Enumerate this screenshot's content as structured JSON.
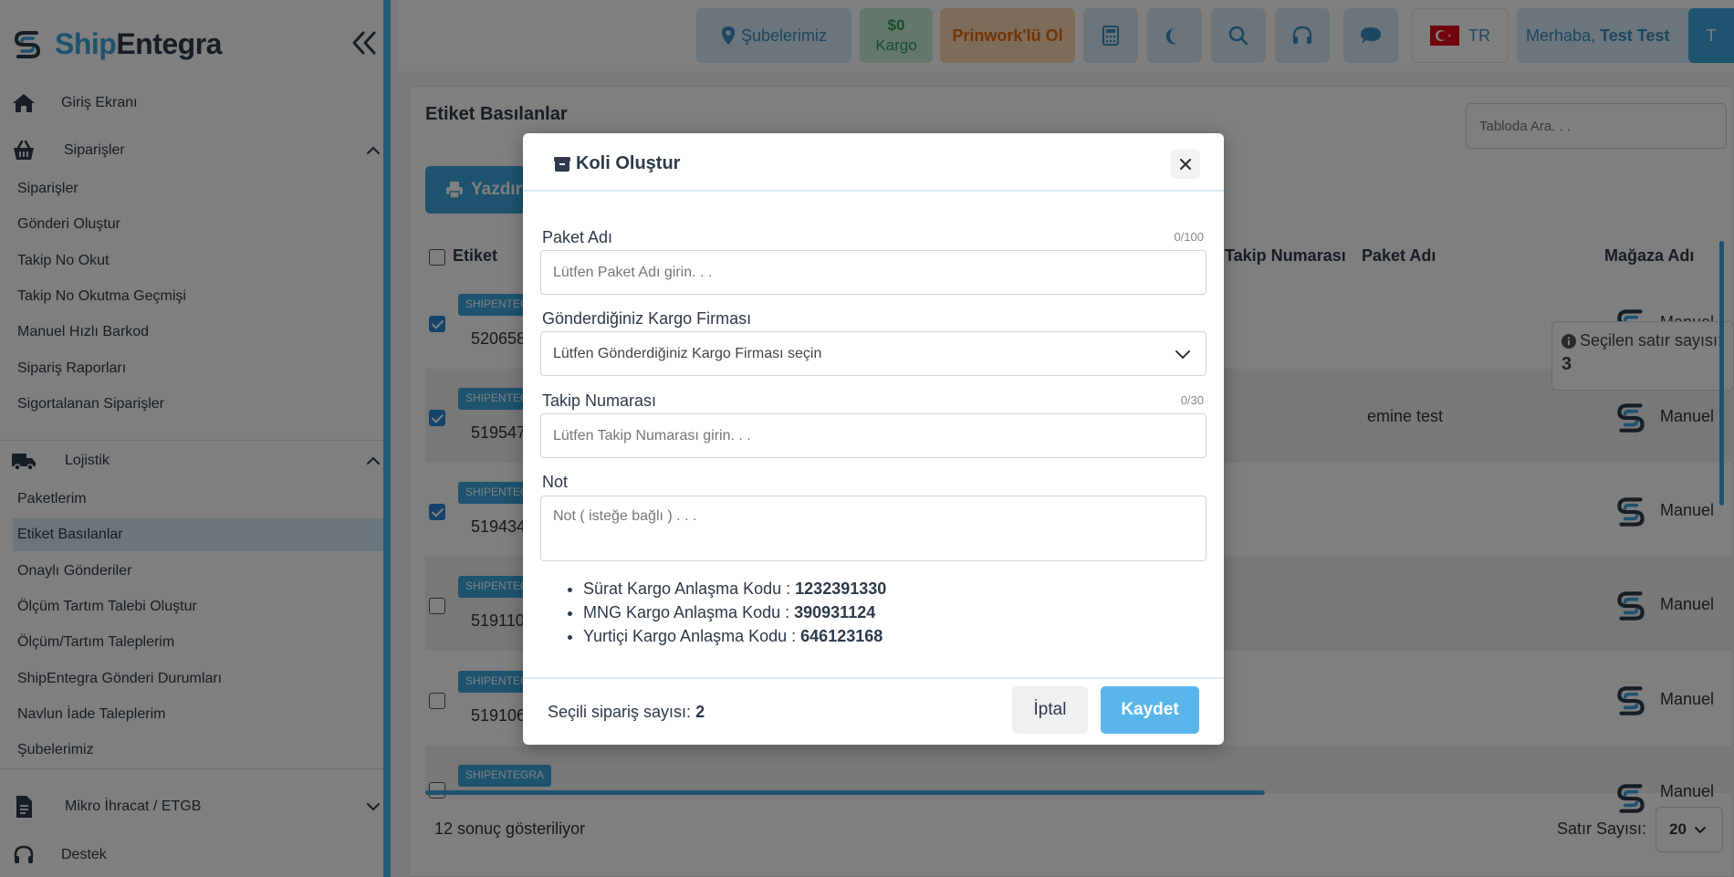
{
  "brand": {
    "name_part1": "Ship",
    "name_part2": "Entegra"
  },
  "sidebar": {
    "sections": [
      {
        "label": "Giriş Ekranı",
        "icon": "home-icon"
      },
      {
        "label": "Siparişler",
        "icon": "basket-icon"
      },
      {
        "label": "Lojistik",
        "icon": "truck-icon"
      },
      {
        "label": "Mikro İhracat / ETGB",
        "icon": "document-icon"
      },
      {
        "label": "Destek",
        "icon": "headset-icon"
      }
    ],
    "siparisler_items": [
      "Siparişler",
      "Gönderi Oluştur",
      "Takip No Okut",
      "Takip No Okutma Geçmişi",
      "Manuel Hızlı Barkod",
      "Sipariş Raporları",
      "Sigortalanan Siparişler"
    ],
    "lojistik_items": [
      "Paketlerim",
      "Etiket Basılanlar",
      "Onaylı Gönderiler",
      "Ölçüm Tartım Talebi Oluştur",
      "Ölçüm/Tartım Taleplerim",
      "ShipEntegra Gönderi Durumları",
      "Navlun İade Taleplerim",
      "Şubelerimiz"
    ],
    "active_item": "Etiket Basılanlar"
  },
  "topbar": {
    "branches": "Şubelerimiz",
    "balance_amount": "$0",
    "balance_label": "Kargo",
    "prinwork": "Prinwork'lü Ol",
    "language": "TR",
    "greeting": "Merhaba,",
    "user_name": "Test Test",
    "avatar_initial": "T"
  },
  "page": {
    "title": "Etiket Basılanlar",
    "search_placeholder": "Tabloda Ara. . .",
    "print_button": "Yazdır",
    "columns": {
      "label": "Etiket",
      "tracking": "Takip Numarası",
      "package": "Paket Adı",
      "store": "Mağaza Adı"
    },
    "rows": [
      {
        "tag": "SHIPENTEGRA",
        "number": "520658",
        "checked": true,
        "package": "",
        "store": "Manuel"
      },
      {
        "tag": "SHIPENTEGRA",
        "number": "519547",
        "checked": true,
        "package": "emine test",
        "store": "Manuel"
      },
      {
        "tag": "SHIPENTEGRA",
        "number": "519434",
        "checked": true,
        "package": "",
        "store": "Manuel"
      },
      {
        "tag": "SHIPENTEGRA",
        "number": "519110",
        "checked": false,
        "package": "",
        "store": "Manuel"
      },
      {
        "tag": "SHIPENTEGRA",
        "number": "519106",
        "checked": false,
        "package": "",
        "store": "Manuel"
      },
      {
        "tag": "SHIPENTEGRA",
        "number": "",
        "checked": false,
        "package": "",
        "store": "Manuel"
      }
    ],
    "selected_tip_label": "Seçilen satır sayısı:",
    "selected_tip_count": "3",
    "results_text": "12 sonuç gösteriliyor",
    "rows_per_page_label": "Satır Sayısı:",
    "rows_per_page_value": "20"
  },
  "modal": {
    "title": "Koli Oluştur",
    "package_name": {
      "label": "Paket Adı",
      "count": "0/100",
      "placeholder": "Lütfen Paket Adı girin. . ."
    },
    "carrier": {
      "label": "Gönderdiğiniz Kargo Firması",
      "placeholder": "Lütfen Gönderdiğiniz Kargo Firması seçin"
    },
    "tracking": {
      "label": "Takip Numarası",
      "count": "0/30",
      "placeholder": "Lütfen Takip Numarası girin. . ."
    },
    "note": {
      "label": "Not",
      "placeholder": "Not ( isteğe bağlı ) . . ."
    },
    "codes": [
      {
        "label": "Sürat Kargo Anlaşma Kodu :",
        "value": "1232391330"
      },
      {
        "label": "MNG Kargo Anlaşma Kodu :",
        "value": "390931124"
      },
      {
        "label": "Yurtiçi Kargo Anlaşma Kodu :",
        "value": "646123168"
      }
    ],
    "selected_count_label": "Seçili sipariş sayısı:",
    "selected_count_value": "2",
    "cancel_button": "İptal",
    "save_button": "Kaydet"
  },
  "colors": {
    "accent": "#3aa6de",
    "brand_dark": "#2d3a4a",
    "prinwork_bg": "#fcd7b0",
    "balance_bg": "#c9eed9"
  }
}
